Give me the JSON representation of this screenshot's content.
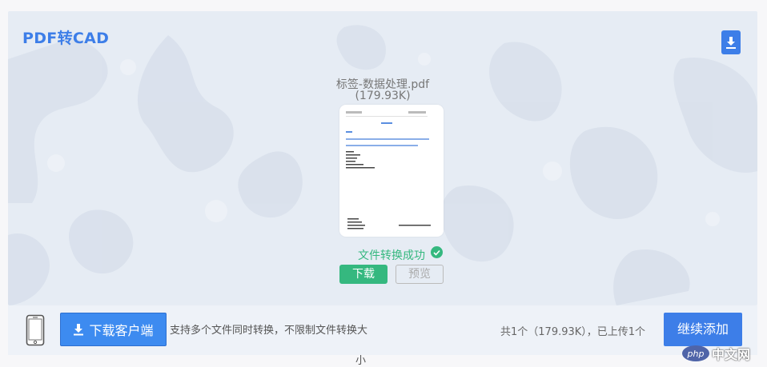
{
  "panel": {
    "title": "PDF转CAD",
    "file_name": "标签-数据处理.pdf",
    "file_size": "(179.93K)",
    "status_text": "文件转换成功",
    "download_label": "下载",
    "preview_label": "预览",
    "download_icon": "download-icon",
    "check_icon": "check-circle-icon",
    "accent_color": "#3d7ee8",
    "success_color": "#35b87f"
  },
  "bottom_bar": {
    "client_button_label": "下载客户端",
    "description": "支持多个文件同时转换，不限制文件转换大",
    "description_wrap": "小",
    "count_text": "共1个（179.93K），已上传1个",
    "add_button_label": "继续添加",
    "phone_icon": "phone-icon"
  },
  "watermark": {
    "logo_text": "php",
    "site_text": "中文网"
  }
}
